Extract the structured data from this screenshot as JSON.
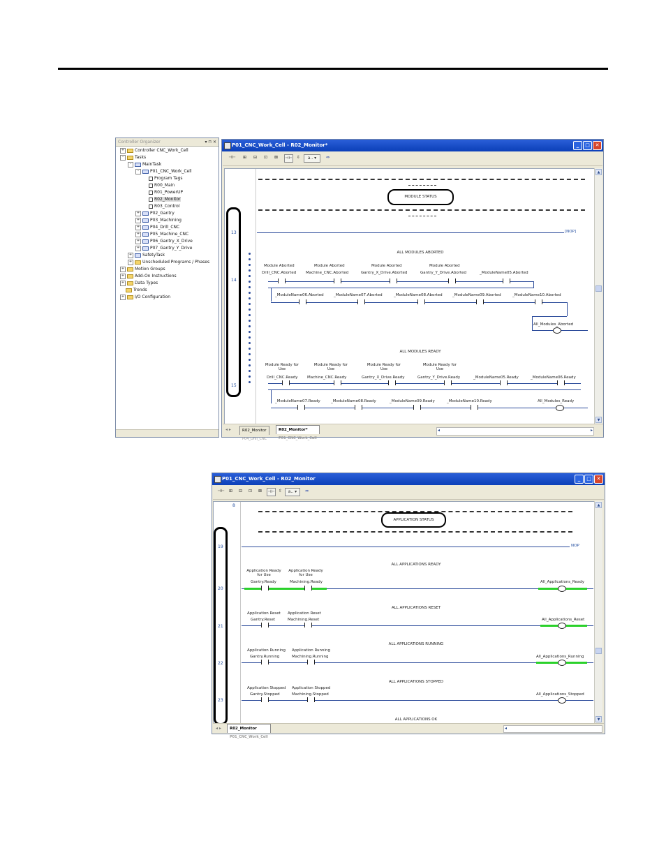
{
  "tree": {
    "title": "Controller Organizer",
    "items": [
      {
        "label": "Controller CNC_Work_Cell",
        "type": "folder",
        "pm": "+"
      },
      {
        "label": "Tasks",
        "type": "folder",
        "pm": "-"
      },
      {
        "label": "MainTask",
        "type": "prog",
        "pm": "-"
      },
      {
        "label": "P01_CNC_Work_Cell",
        "type": "prog",
        "pm": "-"
      },
      {
        "label": "Program Tags",
        "type": "rout",
        "pm": ""
      },
      {
        "label": "R00_Main",
        "type": "rout",
        "pm": ""
      },
      {
        "label": "R01_PowerUP",
        "type": "rout",
        "pm": ""
      },
      {
        "label": "R02_Monitor",
        "type": "rout",
        "pm": "",
        "selected": true
      },
      {
        "label": "R03_Control",
        "type": "rout",
        "pm": ""
      },
      {
        "label": "P02_Gantry",
        "type": "prog",
        "pm": "+"
      },
      {
        "label": "P03_Machining",
        "type": "prog",
        "pm": "+"
      },
      {
        "label": "P04_Drill_CNC",
        "type": "prog",
        "pm": "+"
      },
      {
        "label": "P05_Machine_CNC",
        "type": "prog",
        "pm": "+"
      },
      {
        "label": "P06_Gantry_X_Drive",
        "type": "prog",
        "pm": "+"
      },
      {
        "label": "P07_Gantry_Y_Drive",
        "type": "prog",
        "pm": "+"
      },
      {
        "label": "SafetyTask",
        "type": "prog",
        "pm": "+"
      },
      {
        "label": "Unscheduled Programs / Phases",
        "type": "folder",
        "pm": "+"
      },
      {
        "label": "Motion Groups",
        "type": "folder",
        "pm": "+"
      },
      {
        "label": "Add-On Instructions",
        "type": "folder",
        "pm": "+"
      },
      {
        "label": "Data Types",
        "type": "folder",
        "pm": "+"
      },
      {
        "label": "Trends",
        "type": "folder",
        "pm": ""
      },
      {
        "label": "I/O Configuration",
        "type": "folder",
        "pm": "+"
      }
    ]
  },
  "win1": {
    "title": "P01_CNC_Work_Cell - R02_Monitor*",
    "section_title": "MODULE STATUS",
    "rungs": {
      "r13": "13",
      "r14": "14",
      "r15": "15"
    },
    "nop": "[NOP]",
    "aborted": {
      "header": "ALL MODULES ABORTED",
      "c1_desc": "Module Aborted",
      "c1_tag": "Drill_CNC.Aborted",
      "c2_desc": "Module Aborted",
      "c2_tag": "Machine_CNC.Aborted",
      "c3_desc": "Module Aborted",
      "c3_tag": "Gantry_X_Drive.Aborted",
      "c4_desc": "Module Aborted",
      "c4_tag": "Gantry_Y_Drive.Aborted",
      "c5_tag": "_ModuleName05.Aborted",
      "c6_tag": "_ModuleName06.Aborted",
      "c7_tag": "_ModuleName07.Aborted",
      "c8_tag": "_ModuleName08.Aborted",
      "c9_tag": "_ModuleName09.Aborted",
      "c10_tag": "_ModuleName10.Aborted",
      "coil": "All_Modules_Aborted"
    },
    "ready": {
      "header": "ALL MODULES READY",
      "c1_desc": "Module Ready for Use",
      "c1_tag": "Drill_CNC.Ready",
      "c2_desc": "Module Ready for Use",
      "c2_tag": "Machine_CNC.Ready",
      "c3_desc": "Module Ready for Use",
      "c3_tag": "Gantry_X_Drive.Ready",
      "c4_desc": "Module Ready for Use",
      "c4_tag": "Gantry_Y_Drive.Ready",
      "c5_tag": "_ModuleName05.Ready",
      "c6_tag": "_ModuleName06.Ready",
      "c7_tag": "_ModuleName07.Ready",
      "c8_tag": "_ModuleName08.Ready",
      "c9_tag": "_ModuleName09.Ready",
      "c10_tag": "_ModuleName10.Ready",
      "coil": "All_Modules_Ready"
    },
    "tabs": [
      {
        "label": "R02_Monitor",
        "sub": "P04_Drill_CNC"
      },
      {
        "label": "R02_Monitor*",
        "sub": "P01_CNC_Work_Cell"
      }
    ]
  },
  "win2": {
    "title": "P01_CNC_Work_Cell - R02_Monitor",
    "section_title": "APPLICATION STATUS",
    "rungs": {
      "r8": "8",
      "r19": "19",
      "r20": "20",
      "r21": "21",
      "r22": "22",
      "r23": "23"
    },
    "nop": "NOP",
    "app_ready": {
      "header": "ALL APPLICATIONS READY",
      "c1_desc": "Application Ready for Use",
      "c1_tag": "Gantry.Ready",
      "c2_desc": "Application Ready for Use",
      "c2_tag": "Machining.Ready",
      "coil": "All_Applications_Ready"
    },
    "app_reset": {
      "header": "ALL APPLICATIONS RESET",
      "c1_desc": "Application Reset",
      "c1_tag": "Gantry.Reset",
      "c2_desc": "Application Reset",
      "c2_tag": "Machining.Reset",
      "coil": "All_Applications_Reset"
    },
    "app_running": {
      "header": "ALL APPLICATIONS RUNNING",
      "c1_desc": "Application Running",
      "c1_tag": "Gantry.Running",
      "c2_desc": "Application Running",
      "c2_tag": "Machining.Running",
      "coil": "All_Applications_Running"
    },
    "app_stopped": {
      "header": "ALL APPLICATIONS STOPPED",
      "c1_desc": "Application Stopped",
      "c1_tag": "Gantry.Stopped",
      "c2_desc": "Application Stopped",
      "c2_tag": "Machining.Stopped",
      "coil": "All_Applications_Stopped"
    },
    "app_ok": {
      "header": "ALL APPLICATIONS OK"
    },
    "tabs": [
      {
        "label": "R02_Monitor",
        "sub": "P01_CNC_Work_Cell"
      }
    ]
  },
  "colors": {
    "energized": "#2ad12a",
    "rail": "#2a4a9a",
    "titlebar": "#1047c8"
  }
}
